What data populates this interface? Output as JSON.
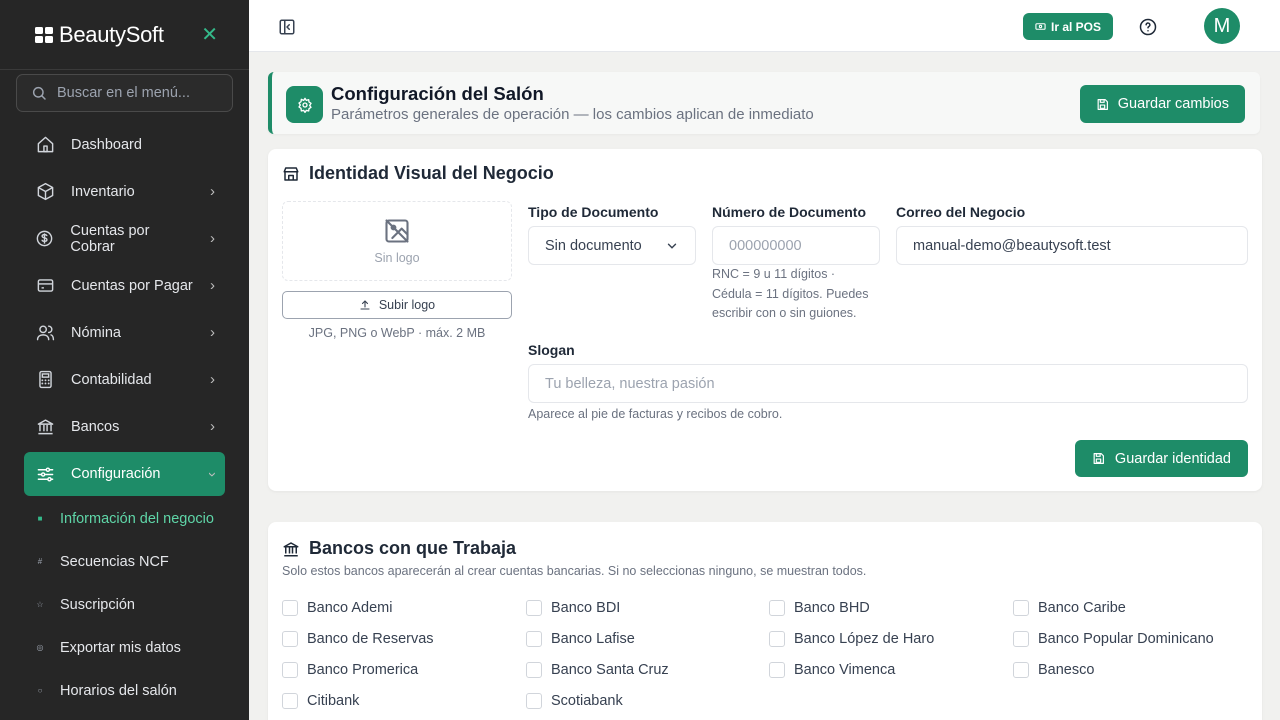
{
  "sidebar": {
    "brand": "BeautySoft",
    "search_placeholder": "Buscar en el menú...",
    "items": [
      {
        "label": "Dashboard",
        "icon": "home-icon"
      },
      {
        "label": "Inventario",
        "icon": "box-icon"
      },
      {
        "label": "Cuentas por Cobrar",
        "icon": "dollar-circle-icon"
      },
      {
        "label": "Cuentas por Pagar",
        "icon": "credit-card-icon"
      },
      {
        "label": "Nómina",
        "icon": "users-icon"
      },
      {
        "label": "Contabilidad",
        "icon": "calculator-icon"
      },
      {
        "label": "Bancos",
        "icon": "bank-icon"
      },
      {
        "label": "Configuración",
        "icon": "sliders-icon"
      }
    ],
    "subitems": [
      {
        "label": "Información del negocio"
      },
      {
        "label": "Secuencias NCF"
      },
      {
        "label": "Suscripción"
      },
      {
        "label": "Exportar mis datos"
      },
      {
        "label": "Horarios del salón"
      }
    ]
  },
  "topbar": {
    "pos_label": "Ir al POS",
    "avatar_initial": "M"
  },
  "header": {
    "title": "Configuración del Salón",
    "subtitle": "Parámetros generales de operación — los cambios aplican de inmediato",
    "save_label": "Guardar cambios"
  },
  "identity": {
    "title": "Identidad Visual del Negocio",
    "logo_empty": "Sin logo",
    "upload_label": "Subir logo",
    "upload_hint": "JPG, PNG o WebP · máx. 2 MB",
    "doc_type_label": "Tipo de Documento",
    "doc_type_value": "Sin documento",
    "doc_number_label": "Número de Documento",
    "doc_number_placeholder": "000000000",
    "doc_hint_1": "RNC = 9 u 11 dígitos ·",
    "doc_hint_2": "Cédula = 11 dígitos. Puedes",
    "doc_hint_3": "escribir con o sin guiones.",
    "email_label": "Correo del Negocio",
    "email_value": "manual-demo@beautysoft.test",
    "slogan_label": "Slogan",
    "slogan_placeholder": "Tu belleza, nuestra pasión",
    "slogan_hint": "Aparece al pie de facturas y recibos de cobro.",
    "save_label": "Guardar identidad"
  },
  "banks": {
    "title": "Bancos con que Trabaja",
    "subtitle": "Solo estos bancos aparecerán al crear cuentas bancarias. Si no seleccionas ninguno, se muestran todos.",
    "list": [
      "Banco Ademi",
      "Banco BDI",
      "Banco BHD",
      "Banco Caribe",
      "Banco de Reservas",
      "Banco Lafise",
      "Banco López de Haro",
      "Banco Popular Dominicano",
      "Banco Promerica",
      "Banco Santa Cruz",
      "Banco Vimenca",
      "Banesco",
      "Citibank",
      "Scotiabank"
    ]
  },
  "colors": {
    "accent": "#1e8c68",
    "sidebar_bg": "#262626",
    "active_sub": "#5fd6a8"
  }
}
